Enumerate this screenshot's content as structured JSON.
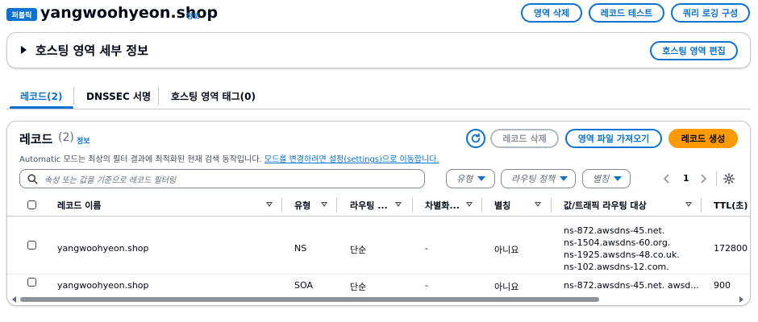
{
  "header": {
    "badge": "퍼블릭",
    "title": "yangwoohyeon.shop",
    "info": "정보",
    "buttons": {
      "delete_zone": "영역 삭제",
      "test_record": "레코드 테스트",
      "query_logging": "쿼리 로깅 구성"
    }
  },
  "details": {
    "title": "호스팅 영역 세부 정보",
    "edit_button": "호스팅 영역 편집"
  },
  "tabs": [
    {
      "label": "레코드(2)",
      "active": true
    },
    {
      "label": "DNSSEC 서명",
      "active": false
    },
    {
      "label": "호스팅 영역 태그(0)",
      "active": false
    }
  ],
  "records": {
    "title": "레코드",
    "count": "(2)",
    "info": "정보",
    "buttons": {
      "delete": "레코드 삭제",
      "import": "영역 파일 가져오기",
      "create": "레코드 생성"
    },
    "notice": "Automatic 모드는 최상의 필터 결과에 최적화된 현재 검색 동작입니다. ",
    "notice_link": "모드를 변경하려면 설정(settings)으로 이동합니다.",
    "search_placeholder": "속성 또는 값을 기준으로 레코드 필터링",
    "filters": {
      "type": "유형",
      "routing": "라우팅 정책",
      "alias": "별칭"
    },
    "pagination": {
      "page": "1"
    },
    "columns": {
      "name": "레코드 이름",
      "type": "유형",
      "routing": "라우팅 ...",
      "differentiator": "차별화...",
      "alias": "별칭",
      "value": "값/트래픽 라우팅 대상",
      "ttl": "TTL(초)"
    },
    "rows": [
      {
        "name": "yangwoohyeon.shop",
        "type": "NS",
        "routing": "단순",
        "differentiator": "-",
        "alias": "아니요",
        "values": [
          "ns-872.awsdns-45.net.",
          "ns-1504.awsdns-60.org.",
          "ns-1925.awsdns-48.co.uk.",
          "ns-102.awsdns-12.com."
        ],
        "ttl": "172800"
      },
      {
        "name": "yangwoohyeon.shop",
        "type": "SOA",
        "routing": "단순",
        "differentiator": "-",
        "alias": "아니요",
        "values": [
          "ns-872.awsdns-45.net. awsd..."
        ],
        "ttl": "900"
      }
    ]
  },
  "colors": {
    "primary": "#0972d3",
    "accent": "#ff9900",
    "border": "#c6c6cd",
    "text": "#000716"
  }
}
